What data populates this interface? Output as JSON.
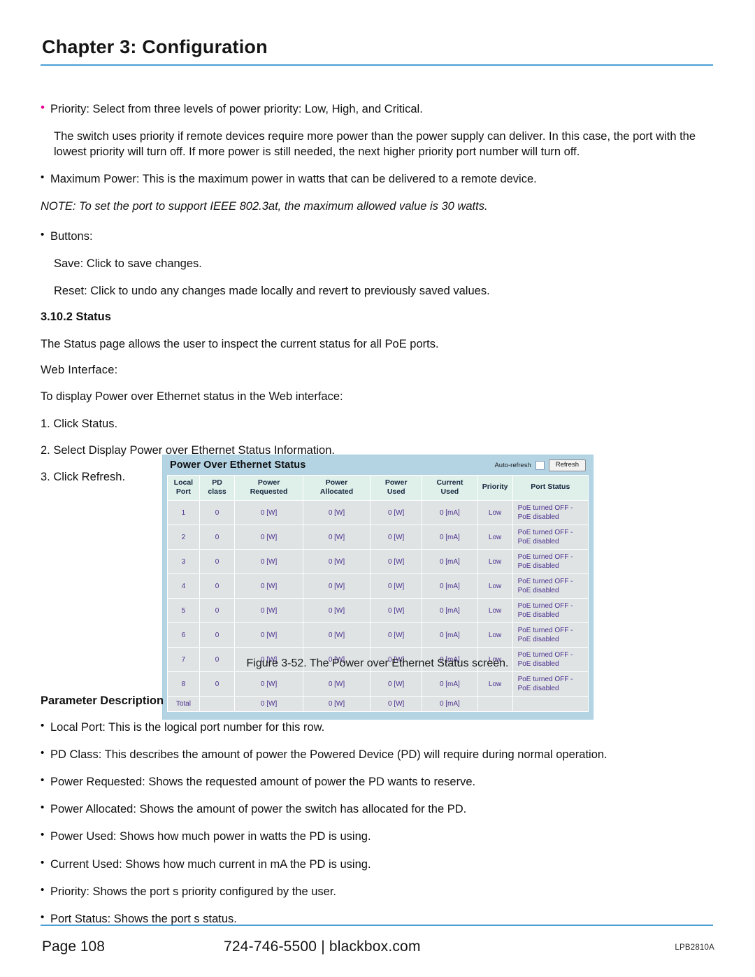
{
  "header": {
    "chapter_title": "Chapter 3: Configuration"
  },
  "body": {
    "bullet_priority": "Priority: Select from three levels of power priority: Low, High, and Critical.",
    "para_priority_detail": "The switch uses priority if remote devices require more power than the power supply can deliver. In this case, the port with the lowest priority will turn off. If more power is still needed, the next higher priority port number will turn off.",
    "bullet_max_power": "Maximum Power: This is the maximum power in watts that can be delivered to a remote device.",
    "note_ieee": "NOTE: To set the port to support IEEE 802.3at, the maximum allowed value is 30 watts.",
    "bullet_buttons": "Buttons:",
    "save_line": "Save: Click to save changes.",
    "reset_line": "Reset: Click to undo any changes made locally and revert to previously saved values.",
    "section_heading": "3.10.2 Status",
    "status_intro": "The Status page allows the user to inspect the current status for all PoE ports.",
    "web_interface_heading": "Web Interface:",
    "web_interface_intro": "To display Power over Ethernet status in the Web interface:",
    "steps": [
      "1. Click  Status.",
      "2. Select Display Power over Ethernet Status Information.",
      "3. Click  Refresh."
    ]
  },
  "figure": {
    "caption": "Figure 3-52. The Power over Ethernet Status screen.",
    "app": {
      "title": "Power Over Ethernet Status",
      "autorefresh_label": "Auto-refresh",
      "refresh_button": "Refresh",
      "columns": [
        "Local Port",
        "PD class",
        "Power Requested",
        "Power Allocated",
        "Power Used",
        "Current Used",
        "Priority",
        "Port Status"
      ],
      "columns_split": [
        [
          "Local",
          "Port"
        ],
        [
          "PD",
          "class"
        ],
        [
          "Power",
          "Requested"
        ],
        [
          "Power",
          "Allocated"
        ],
        [
          "Power",
          "Used"
        ],
        [
          "Current",
          "Used"
        ],
        [
          "Priority",
          ""
        ],
        [
          "Port Status",
          ""
        ]
      ],
      "rows": [
        {
          "port": "1",
          "pd_class": "0",
          "power_requested": "0 [W]",
          "power_allocated": "0 [W]",
          "power_used": "0 [W]",
          "current_used": "0 [mA]",
          "priority": "Low",
          "port_status": "PoE turned OFF - PoE disabled"
        },
        {
          "port": "2",
          "pd_class": "0",
          "power_requested": "0 [W]",
          "power_allocated": "0 [W]",
          "power_used": "0 [W]",
          "current_used": "0 [mA]",
          "priority": "Low",
          "port_status": "PoE turned OFF - PoE disabled"
        },
        {
          "port": "3",
          "pd_class": "0",
          "power_requested": "0 [W]",
          "power_allocated": "0 [W]",
          "power_used": "0 [W]",
          "current_used": "0 [mA]",
          "priority": "Low",
          "port_status": "PoE turned OFF - PoE disabled"
        },
        {
          "port": "4",
          "pd_class": "0",
          "power_requested": "0 [W]",
          "power_allocated": "0 [W]",
          "power_used": "0 [W]",
          "current_used": "0 [mA]",
          "priority": "Low",
          "port_status": "PoE turned OFF - PoE disabled"
        },
        {
          "port": "5",
          "pd_class": "0",
          "power_requested": "0 [W]",
          "power_allocated": "0 [W]",
          "power_used": "0 [W]",
          "current_used": "0 [mA]",
          "priority": "Low",
          "port_status": "PoE turned OFF - PoE disabled"
        },
        {
          "port": "6",
          "pd_class": "0",
          "power_requested": "0 [W]",
          "power_allocated": "0 [W]",
          "power_used": "0 [W]",
          "current_used": "0 [mA]",
          "priority": "Low",
          "port_status": "PoE turned OFF - PoE disabled"
        },
        {
          "port": "7",
          "pd_class": "0",
          "power_requested": "0 [W]",
          "power_allocated": "0 [W]",
          "power_used": "0 [W]",
          "current_used": "0 [mA]",
          "priority": "Low",
          "port_status": "PoE turned OFF - PoE disabled"
        },
        {
          "port": "8",
          "pd_class": "0",
          "power_requested": "0 [W]",
          "power_allocated": "0 [W]",
          "power_used": "0 [W]",
          "current_used": "0 [mA]",
          "priority": "Low",
          "port_status": "PoE turned OFF - PoE disabled"
        },
        {
          "port": "Total",
          "pd_class": "",
          "power_requested": "0 [W]",
          "power_allocated": "0 [W]",
          "power_used": "0 [W]",
          "current_used": "0 [mA]",
          "priority": "",
          "port_status": ""
        }
      ]
    }
  },
  "parameters": {
    "heading": "Parameter Description",
    "items": [
      "Local Port: This is the logical port number for this row.",
      "PD Class: This describes the amount of power the Powered Device (PD) will require during normal operation.",
      "Power Requested:  Shows the requested amount of power the PD wants to reserve.",
      "Power Allocated: Shows the amount of power the switch has allocated for the PD.",
      "Power Used: Shows how much power in watts the PD is using.",
      "Current Used: Shows how much current in mA the PD is using.",
      "Priority: Shows the port s priority configured by the user.",
      "Port Status: Shows the port s status."
    ]
  },
  "footer": {
    "page_label": "Page 108",
    "phone": "724-746-5500",
    "separator": "|",
    "website": "blackbox.com",
    "doc_code": "LPB2810A"
  },
  "colors": {
    "rule_blue": "#4a9fd5",
    "panel_blue": "#b4d4e4",
    "table_header_mint": "#dff0ea",
    "table_cell_gray": "#dfe3e3",
    "table_text_purple": "#4b2f8f",
    "bullet_magenta": "#e6008c"
  }
}
